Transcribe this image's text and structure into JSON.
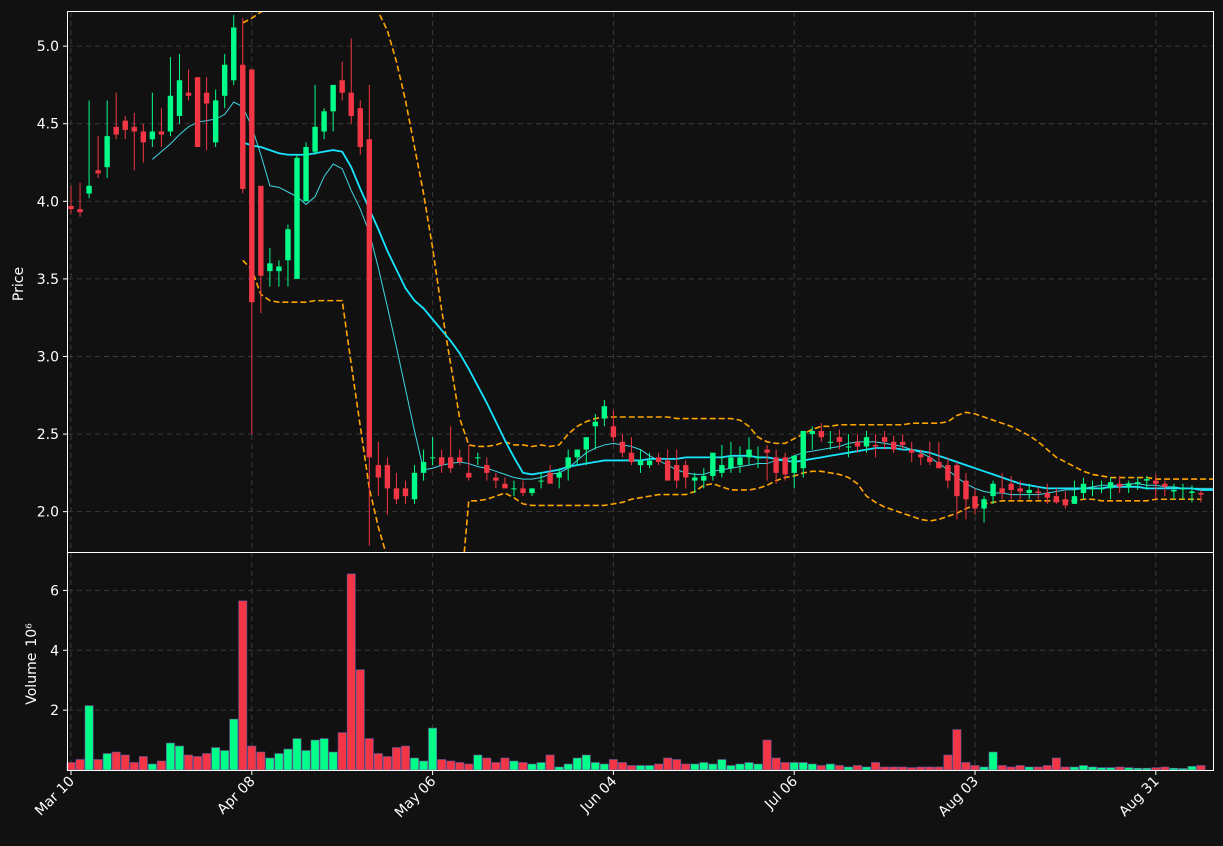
{
  "chart_data": {
    "type": "candlestick",
    "price_panel": {
      "ylabel": "Price",
      "ylim": [
        1.74,
        5.22
      ],
      "yticks": [
        2.0,
        2.5,
        3.0,
        3.5,
        4.0,
        4.5,
        5.0
      ],
      "ytick_labels": [
        "2.0",
        "2.5",
        "3.0",
        "3.5",
        "4.0",
        "4.5",
        "5.0"
      ],
      "grid": true
    },
    "volume_panel": {
      "ylabel": "Volume",
      "ylabel_exponent": "10⁶",
      "ylim": [
        0,
        7.25
      ],
      "yticks": [
        2,
        4,
        6
      ],
      "ytick_labels": [
        "2",
        "4",
        "6"
      ],
      "grid": true
    },
    "xaxis": {
      "tick_labels": [
        "Mar 10",
        "Apr 08",
        "May 06",
        "Jun 04",
        "Jul 06",
        "Aug 03",
        "Aug 31"
      ],
      "tick_indices": [
        0,
        20,
        40,
        60,
        80,
        100,
        120
      ]
    },
    "colors": {
      "background": "#111111",
      "up": "#00ff88",
      "down": "#f23645",
      "ma_fast": "#3fd7e4",
      "ma_slow": "#16e6ff",
      "bands": "#ffa500",
      "grid": "#3a3a3a",
      "axes": "#ffffff"
    },
    "dates": [
      "Mar 10",
      "Mar 11",
      "Mar 12",
      "Mar 13",
      "Mar 14",
      "Mar 17",
      "Mar 18",
      "Mar 19",
      "Mar 20",
      "Mar 21",
      "Mar 24",
      "Mar 25",
      "Mar 26",
      "Mar 27",
      "Mar 28",
      "Mar 31",
      "Apr 01",
      "Apr 02",
      "Apr 03",
      "Apr 04",
      "Apr 08",
      "Apr 09",
      "Apr 10",
      "Apr 11",
      "Apr 14",
      "Apr 15",
      "Apr 16",
      "Apr 17",
      "Apr 18",
      "Apr 21",
      "Apr 22",
      "Apr 23",
      "Apr 24",
      "Apr 25",
      "Apr 28",
      "Apr 29",
      "Apr 30",
      "May 01",
      "May 02",
      "May 05",
      "May 06",
      "May 07",
      "May 08",
      "May 09",
      "May 12",
      "May 13",
      "May 14",
      "May 15",
      "May 16",
      "May 19",
      "May 20",
      "May 21",
      "May 22",
      "May 23",
      "May 26",
      "May 27",
      "May 28",
      "May 29",
      "May 30",
      "Jun 02",
      "Jun 04",
      "Jun 05",
      "Jun 06",
      "Jun 09",
      "Jun 10",
      "Jun 11",
      "Jun 12",
      "Jun 13",
      "Jun 16",
      "Jun 17",
      "Jun 18",
      "Jun 19",
      "Jun 20",
      "Jun 23",
      "Jun 24",
      "Jun 25",
      "Jun 26",
      "Jun 27",
      "Jun 30",
      "Jul 01",
      "Jul 06",
      "Jul 07",
      "Jul 08",
      "Jul 09",
      "Jul 10",
      "Jul 11",
      "Jul 14",
      "Jul 15",
      "Jul 16",
      "Jul 17",
      "Jul 18",
      "Jul 21",
      "Jul 22",
      "Jul 23",
      "Jul 24",
      "Jul 25",
      "Jul 28",
      "Jul 29",
      "Jul 30",
      "Jul 31",
      "Aug 03",
      "Aug 04",
      "Aug 05",
      "Aug 06",
      "Aug 07",
      "Aug 10",
      "Aug 11",
      "Aug 12",
      "Aug 13",
      "Aug 14",
      "Aug 17",
      "Aug 18",
      "Aug 19",
      "Aug 20",
      "Aug 21",
      "Aug 24",
      "Aug 25",
      "Aug 26",
      "Aug 27",
      "Aug 28",
      "Aug 31",
      "Sep 01",
      "Sep 02",
      "Sep 03",
      "Sep 04",
      "Sep 07"
    ],
    "open": [
      3.97,
      3.95,
      4.05,
      4.2,
      4.22,
      4.48,
      4.52,
      4.48,
      4.45,
      4.4,
      4.45,
      4.45,
      4.55,
      4.7,
      4.8,
      4.7,
      4.38,
      4.68,
      4.78,
      4.88,
      4.85,
      4.1,
      3.55,
      3.55,
      3.62,
      3.5,
      4.0,
      4.32,
      4.45,
      4.58,
      4.78,
      4.7,
      4.6,
      4.4,
      2.3,
      2.3,
      2.15,
      2.15,
      2.08,
      2.25,
      2.35,
      2.35,
      2.35,
      2.35,
      2.25,
      2.35,
      2.3,
      2.22,
      2.18,
      2.15,
      2.15,
      2.12,
      2.2,
      2.25,
      2.22,
      2.28,
      2.35,
      2.4,
      2.55,
      2.6,
      2.55,
      2.45,
      2.38,
      2.3,
      2.3,
      2.35,
      2.33,
      2.3,
      2.3,
      2.2,
      2.2,
      2.23,
      2.25,
      2.28,
      2.3,
      2.35,
      2.35,
      2.4,
      2.35,
      2.35,
      2.25,
      2.28,
      2.5,
      2.52,
      2.45,
      2.48,
      2.42,
      2.45,
      2.42,
      2.43,
      2.48,
      2.45,
      2.45,
      2.4,
      2.37,
      2.35,
      2.32,
      2.3,
      2.3,
      2.2,
      2.1,
      2.02,
      2.1,
      2.15,
      2.18,
      2.15,
      2.12,
      2.13,
      2.12,
      2.1,
      2.08,
      2.05,
      2.12,
      2.15,
      2.15,
      2.15,
      2.18,
      2.16,
      2.18,
      2.2,
      2.2,
      2.18,
      2.13,
      2.15,
      2.12,
      2.12,
      2.11,
      2.13
    ],
    "high": [
      4.1,
      4.12,
      4.65,
      4.42,
      4.65,
      4.7,
      4.55,
      4.57,
      4.5,
      4.7,
      4.6,
      4.93,
      4.95,
      4.85,
      4.8,
      4.8,
      4.72,
      4.95,
      5.2,
      5.18,
      4.2,
      4.0,
      3.7,
      3.62,
      3.85,
      4.3,
      4.38,
      4.75,
      4.6,
      4.7,
      4.9,
      5.05,
      4.65,
      4.75,
      2.45,
      2.35,
      2.25,
      2.2,
      2.3,
      2.4,
      2.48,
      2.4,
      2.55,
      2.4,
      2.43,
      2.38,
      2.35,
      2.25,
      2.22,
      2.2,
      2.2,
      2.15,
      2.25,
      2.3,
      2.28,
      2.4,
      2.38,
      2.45,
      2.63,
      2.72,
      2.65,
      2.5,
      2.48,
      2.4,
      2.38,
      2.38,
      2.4,
      2.4,
      2.33,
      2.25,
      2.28,
      2.35,
      2.43,
      2.45,
      2.42,
      2.48,
      2.42,
      2.43,
      2.4,
      2.38,
      2.32,
      2.4,
      2.55,
      2.57,
      2.52,
      2.53,
      2.5,
      2.5,
      2.52,
      2.5,
      2.52,
      2.49,
      2.5,
      2.45,
      2.4,
      2.45,
      2.45,
      2.35,
      2.32,
      2.25,
      2.15,
      2.1,
      2.2,
      2.25,
      2.23,
      2.2,
      2.18,
      2.16,
      2.18,
      2.15,
      2.13,
      2.2,
      2.22,
      2.2,
      2.2,
      2.22,
      2.23,
      2.2,
      2.22,
      2.23,
      2.24,
      2.2,
      2.18,
      2.18,
      2.17,
      2.14,
      2.16,
      2.17
    ],
    "low": [
      3.92,
      3.9,
      4.02,
      4.15,
      4.15,
      4.4,
      4.4,
      4.2,
      4.25,
      4.35,
      4.35,
      4.42,
      4.5,
      4.65,
      4.55,
      4.33,
      4.35,
      4.6,
      4.75,
      4.05,
      2.5,
      3.28,
      3.45,
      3.45,
      3.45,
      3.95,
      4.2,
      4.3,
      4.4,
      4.45,
      4.65,
      4.5,
      4.3,
      1.78,
      2.1,
      1.98,
      2.05,
      2.05,
      2.05,
      2.2,
      2.3,
      2.25,
      2.25,
      2.3,
      2.2,
      2.3,
      2.2,
      2.15,
      2.15,
      2.1,
      2.1,
      2.1,
      2.15,
      2.2,
      2.15,
      2.2,
      2.3,
      2.3,
      2.4,
      2.55,
      2.45,
      2.35,
      2.3,
      2.25,
      2.28,
      2.3,
      2.25,
      2.15,
      2.15,
      2.12,
      2.15,
      2.2,
      2.22,
      2.25,
      2.25,
      2.3,
      2.28,
      2.2,
      2.18,
      2.2,
      2.15,
      2.22,
      2.4,
      2.45,
      2.4,
      2.4,
      2.35,
      2.38,
      2.38,
      2.35,
      2.4,
      2.38,
      2.4,
      2.32,
      2.3,
      2.3,
      2.28,
      2.15,
      1.95,
      1.95,
      1.98,
      1.93,
      2.05,
      2.08,
      2.08,
      2.08,
      2.08,
      2.08,
      2.05,
      2.05,
      2.02,
      2.05,
      2.08,
      2.1,
      2.12,
      2.08,
      2.12,
      2.12,
      2.14,
      2.14,
      2.08,
      2.1,
      2.08,
      2.08,
      2.06,
      2.06,
      2.08,
      2.1
    ],
    "close": [
      3.95,
      3.93,
      4.1,
      4.18,
      4.42,
      4.43,
      4.46,
      4.45,
      4.38,
      4.45,
      4.43,
      4.68,
      4.78,
      4.68,
      4.35,
      4.63,
      4.65,
      4.88,
      5.12,
      4.08,
      3.35,
      3.52,
      3.6,
      3.58,
      3.82,
      4.28,
      4.35,
      4.48,
      4.58,
      4.75,
      4.7,
      4.55,
      4.35,
      2.35,
      2.22,
      2.15,
      2.08,
      2.1,
      2.25,
      2.32,
      2.35,
      2.3,
      2.28,
      2.32,
      2.22,
      2.35,
      2.25,
      2.2,
      2.15,
      2.15,
      2.12,
      2.15,
      2.2,
      2.18,
      2.25,
      2.35,
      2.4,
      2.48,
      2.58,
      2.68,
      2.48,
      2.38,
      2.32,
      2.33,
      2.33,
      2.32,
      2.2,
      2.2,
      2.22,
      2.22,
      2.23,
      2.38,
      2.3,
      2.35,
      2.35,
      2.4,
      2.35,
      2.38,
      2.25,
      2.24,
      2.36,
      2.52,
      2.52,
      2.48,
      2.45,
      2.45,
      2.42,
      2.42,
      2.48,
      2.42,
      2.45,
      2.4,
      2.43,
      2.38,
      2.35,
      2.32,
      2.28,
      2.2,
      2.1,
      2.08,
      2.02,
      2.08,
      2.18,
      2.12,
      2.14,
      2.13,
      2.14,
      2.12,
      2.09,
      2.06,
      2.04,
      2.1,
      2.18,
      2.15,
      2.15,
      2.19,
      2.16,
      2.18,
      2.19,
      2.21,
      2.18,
      2.16,
      2.14,
      2.15,
      2.13,
      2.11,
      2.13,
      2.14
    ],
    "volume": [
      0.25,
      0.35,
      2.15,
      0.35,
      0.55,
      0.6,
      0.5,
      0.25,
      0.45,
      0.2,
      0.3,
      0.9,
      0.8,
      0.5,
      0.45,
      0.55,
      0.75,
      0.65,
      1.7,
      5.65,
      0.8,
      0.6,
      0.4,
      0.55,
      0.7,
      1.05,
      0.65,
      1.0,
      1.05,
      0.6,
      1.25,
      6.55,
      3.35,
      1.05,
      0.55,
      0.45,
      0.75,
      0.8,
      0.4,
      0.3,
      1.4,
      0.35,
      0.3,
      0.25,
      0.2,
      0.5,
      0.4,
      0.25,
      0.4,
      0.3,
      0.25,
      0.2,
      0.25,
      0.5,
      0.1,
      0.2,
      0.4,
      0.5,
      0.25,
      0.2,
      0.35,
      0.25,
      0.15,
      0.15,
      0.15,
      0.2,
      0.4,
      0.35,
      0.2,
      0.2,
      0.25,
      0.2,
      0.35,
      0.15,
      0.2,
      0.25,
      0.2,
      1.0,
      0.4,
      0.25,
      0.25,
      0.25,
      0.2,
      0.15,
      0.2,
      0.15,
      0.1,
      0.15,
      0.1,
      0.25,
      0.1,
      0.1,
      0.1,
      0.08,
      0.1,
      0.1,
      0.1,
      0.5,
      1.35,
      0.25,
      0.15,
      0.1,
      0.6,
      0.15,
      0.1,
      0.15,
      0.1,
      0.1,
      0.15,
      0.4,
      0.1,
      0.1,
      0.15,
      0.1,
      0.08,
      0.08,
      0.1,
      0.08,
      0.06,
      0.06,
      0.08,
      0.1,
      0.06,
      0.05,
      0.12,
      0.15,
      0.15,
      0.2
    ],
    "ma_fast": [
      null,
      null,
      null,
      null,
      null,
      null,
      null,
      null,
      null,
      4.27,
      4.32,
      4.37,
      4.43,
      4.48,
      4.51,
      4.52,
      4.53,
      4.56,
      4.64,
      4.61,
      4.48,
      4.3,
      4.1,
      4.09,
      4.06,
      4.03,
      3.98,
      4.03,
      4.16,
      4.24,
      4.21,
      4.07,
      3.95,
      3.8,
      3.57,
      3.32,
      3.06,
      2.79,
      2.52,
      2.27,
      2.28,
      2.3,
      2.31,
      2.32,
      2.31,
      2.29,
      2.28,
      2.26,
      2.24,
      2.22,
      2.21,
      2.21,
      2.22,
      2.24,
      2.25,
      2.28,
      2.33,
      2.38,
      2.41,
      2.43,
      2.44,
      2.43,
      2.42,
      2.4,
      2.36,
      2.33,
      2.3,
      2.27,
      2.25,
      2.24,
      2.24,
      2.26,
      2.27,
      2.28,
      2.29,
      2.3,
      2.31,
      2.31,
      2.33,
      2.33,
      2.36,
      2.38,
      2.39,
      2.4,
      2.41,
      2.42,
      2.44,
      2.45,
      2.45,
      2.45,
      2.44,
      2.43,
      2.42,
      2.4,
      2.38,
      2.35,
      2.31,
      2.27,
      2.22,
      2.18,
      2.15,
      2.13,
      2.12,
      2.12,
      2.11,
      2.11,
      2.11,
      2.11,
      2.12,
      2.13,
      2.14,
      2.14,
      2.15,
      2.16,
      2.17,
      2.17,
      2.17,
      2.18,
      2.18,
      2.17,
      2.17,
      2.16,
      2.16,
      2.15,
      2.15,
      2.15,
      2.15,
      2.14
    ],
    "ma_slow": [
      null,
      null,
      null,
      null,
      null,
      null,
      null,
      null,
      null,
      null,
      null,
      null,
      null,
      null,
      null,
      null,
      null,
      null,
      null,
      4.38,
      4.36,
      4.35,
      4.33,
      4.31,
      4.3,
      4.3,
      4.3,
      4.31,
      4.32,
      4.33,
      4.32,
      4.22,
      4.08,
      3.95,
      3.82,
      3.68,
      3.56,
      3.44,
      3.36,
      3.31,
      3.24,
      3.17,
      3.1,
      3.02,
      2.92,
      2.81,
      2.7,
      2.58,
      2.46,
      2.35,
      2.25,
      2.24,
      2.25,
      2.26,
      2.27,
      2.29,
      2.3,
      2.31,
      2.32,
      2.33,
      2.33,
      2.33,
      2.33,
      2.33,
      2.34,
      2.34,
      2.34,
      2.34,
      2.35,
      2.35,
      2.35,
      2.35,
      2.35,
      2.36,
      2.36,
      2.36,
      2.35,
      2.35,
      2.34,
      2.33,
      2.32,
      2.33,
      2.34,
      2.35,
      2.36,
      2.37,
      2.38,
      2.39,
      2.4,
      2.41,
      2.41,
      2.41,
      2.4,
      2.4,
      2.39,
      2.38,
      2.36,
      2.34,
      2.32,
      2.3,
      2.28,
      2.26,
      2.24,
      2.22,
      2.2,
      2.18,
      2.17,
      2.16,
      2.15,
      2.15,
      2.15,
      2.15,
      2.15,
      2.15,
      2.15,
      2.16,
      2.16,
      2.16,
      2.16,
      2.15,
      2.15,
      2.15,
      2.15,
      2.15,
      2.15,
      2.14,
      2.14,
      2.14
    ],
    "band_upper": [
      null,
      null,
      null,
      null,
      null,
      null,
      null,
      null,
      null,
      null,
      null,
      null,
      null,
      null,
      null,
      null,
      null,
      null,
      null,
      5.15,
      5.18,
      5.22,
      5.25,
      5.28,
      5.3,
      5.32,
      5.33,
      5.32,
      5.3,
      5.26,
      5.26,
      5.32,
      5.35,
      5.3,
      5.22,
      5.1,
      4.9,
      4.65,
      4.35,
      4.05,
      3.7,
      3.3,
      2.95,
      2.6,
      2.43,
      2.42,
      2.42,
      2.43,
      2.45,
      2.43,
      2.43,
      2.42,
      2.43,
      2.42,
      2.43,
      2.5,
      2.55,
      2.58,
      2.6,
      2.61,
      2.61,
      2.61,
      2.61,
      2.61,
      2.61,
      2.61,
      2.61,
      2.6,
      2.6,
      2.6,
      2.6,
      2.6,
      2.6,
      2.6,
      2.59,
      2.55,
      2.48,
      2.45,
      2.44,
      2.44,
      2.47,
      2.5,
      2.53,
      2.55,
      2.55,
      2.56,
      2.56,
      2.56,
      2.56,
      2.56,
      2.56,
      2.56,
      2.56,
      2.57,
      2.57,
      2.57,
      2.57,
      2.58,
      2.62,
      2.64,
      2.63,
      2.61,
      2.59,
      2.57,
      2.55,
      2.52,
      2.49,
      2.45,
      2.4,
      2.35,
      2.32,
      2.29,
      2.26,
      2.24,
      2.23,
      2.22,
      2.22,
      2.22,
      2.22,
      2.22,
      2.21,
      2.21,
      2.21,
      2.21,
      2.21,
      2.21,
      2.21,
      2.21
    ],
    "band_lower": [
      null,
      null,
      null,
      null,
      null,
      null,
      null,
      null,
      null,
      null,
      null,
      null,
      null,
      null,
      null,
      null,
      null,
      null,
      null,
      3.62,
      3.56,
      3.4,
      3.36,
      3.35,
      3.35,
      3.35,
      3.35,
      3.36,
      3.36,
      3.36,
      3.36,
      2.95,
      2.55,
      2.15,
      1.9,
      1.7,
      1.5,
      1.3,
      1.1,
      1.0,
      0.95,
      0.95,
      1.0,
      1.4,
      2.07,
      2.07,
      2.08,
      2.1,
      2.12,
      2.09,
      2.05,
      2.04,
      2.04,
      2.04,
      2.04,
      2.04,
      2.04,
      2.04,
      2.04,
      2.04,
      2.05,
      2.06,
      2.08,
      2.09,
      2.1,
      2.11,
      2.11,
      2.11,
      2.11,
      2.13,
      2.17,
      2.18,
      2.16,
      2.14,
      2.14,
      2.14,
      2.15,
      2.17,
      2.2,
      2.22,
      2.23,
      2.25,
      2.26,
      2.26,
      2.25,
      2.24,
      2.22,
      2.18,
      2.1,
      2.06,
      2.03,
      2.01,
      1.99,
      1.97,
      1.95,
      1.94,
      1.95,
      1.97,
      1.99,
      2.02,
      2.04,
      2.05,
      2.06,
      2.07,
      2.07,
      2.07,
      2.07,
      2.07,
      2.07,
      2.07,
      2.07,
      2.07,
      2.08,
      2.08,
      2.07,
      2.07,
      2.07,
      2.07,
      2.07,
      2.07,
      2.08,
      2.08,
      2.08,
      2.08,
      2.08,
      2.08
    ]
  }
}
